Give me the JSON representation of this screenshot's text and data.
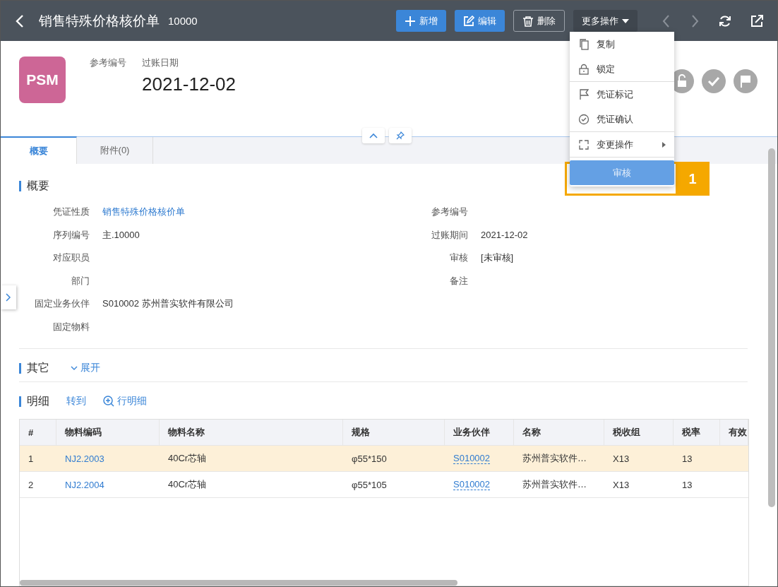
{
  "header": {
    "title": "销售特殊价格核价单",
    "number": "10000",
    "buttons": [
      {
        "label": "新增",
        "kind": "primary"
      },
      {
        "label": "编辑",
        "kind": "primary"
      },
      {
        "label": "删除",
        "kind": "outline"
      },
      {
        "label": "更多操作",
        "kind": "dropdown"
      }
    ]
  },
  "summary": {
    "badge": "PSM",
    "fields": [
      {
        "label": "参考编号"
      },
      {
        "label": "过账日期",
        "value": "2021-12-02"
      }
    ]
  },
  "tabs": [
    {
      "label": "概要",
      "selected": true
    },
    {
      "label": "附件(0)",
      "selected": false
    }
  ],
  "menu": {
    "groups": [
      [
        {
          "label": "复制",
          "submenu": false,
          "selected": false
        },
        {
          "label": "锁定",
          "submenu": false,
          "selected": false
        }
      ],
      [
        {
          "label": "凭证标记",
          "submenu": false,
          "selected": false
        },
        {
          "label": "凭证确认",
          "submenu": false,
          "selected": false
        }
      ],
      [
        {
          "label": "变更操作",
          "submenu": true,
          "selected": false
        }
      ],
      [
        {
          "label": "审核",
          "submenu": false,
          "selected": true
        }
      ]
    ]
  },
  "callout": {
    "label": "1"
  },
  "overview": {
    "title": "概要",
    "left": [
      {
        "label": "凭证性质",
        "value": "销售特殊价格核价单",
        "link": true
      },
      {
        "label": "序列编号",
        "value": "主.10000",
        "link": false
      },
      {
        "label": "对应职员"
      },
      {
        "label": "部门"
      },
      {
        "label": "固定业务伙伴",
        "value": "S010002 苏州普实软件有限公司",
        "link": false
      },
      {
        "label": "固定物料"
      }
    ],
    "right": [
      {
        "label": "参考编号"
      },
      {
        "label": "过账期间",
        "value": "2021-12-02"
      },
      {
        "label": "审核",
        "value": "[未审核]"
      },
      {
        "label": "备注"
      }
    ]
  },
  "other": {
    "title": "其它",
    "action": "展开"
  },
  "detail": {
    "title": "明细",
    "actions": [
      "转到",
      "行明细"
    ],
    "columns": [
      "#",
      "物料编码",
      "物料名称",
      "规格",
      "业务伙伴",
      "名称",
      "税收组",
      "税率",
      "有效"
    ],
    "rows": [
      {
        "selected": true,
        "cells": [
          "1",
          "NJ2.2003",
          "40Cr芯轴",
          "φ55*150",
          "S010002",
          "苏州普实软件…",
          "X13",
          "13",
          ""
        ]
      },
      {
        "selected": false,
        "cells": [
          "2",
          "NJ2.2004",
          "40Cr芯轴",
          "φ55*105",
          "S010002",
          "苏州普实软件…",
          "X13",
          "13",
          ""
        ]
      }
    ]
  }
}
